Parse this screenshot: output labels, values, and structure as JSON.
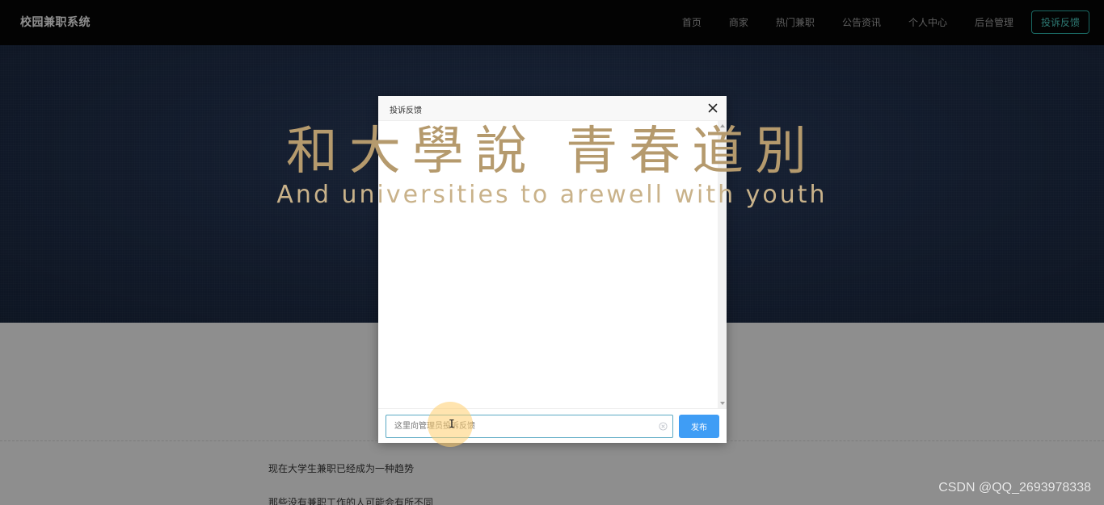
{
  "navbar": {
    "brand": "校园兼职系统",
    "items": [
      {
        "label": "首页"
      },
      {
        "label": "商家"
      },
      {
        "label": "热门兼职"
      },
      {
        "label": "公告资讯"
      },
      {
        "label": "个人中心"
      },
      {
        "label": "后台管理"
      }
    ],
    "feedback_button": "投诉反馈"
  },
  "hero": {
    "title_cn_visible": "和大學說                    青春道別",
    "subtitle_en_visible": "And universities to                              arewell with youth"
  },
  "content": {
    "lines": [
      "现在大学生兼职已经成为一种趋势",
      "那些没有兼职工作的人可能会有所不同"
    ]
  },
  "modal": {
    "title": "投诉反馈",
    "input_placeholder": "这里向管理员投诉反馈",
    "publish_button": "发布",
    "icons": {
      "close": "close-icon",
      "clear": "clear-icon"
    }
  },
  "watermark": "CSDN @QQ_2693978338",
  "colors": {
    "navbar_bg": "#050505",
    "accent_teal": "#2aa8a0",
    "publish_blue": "#3f9df5",
    "hero_gold": "#b59a6d"
  }
}
